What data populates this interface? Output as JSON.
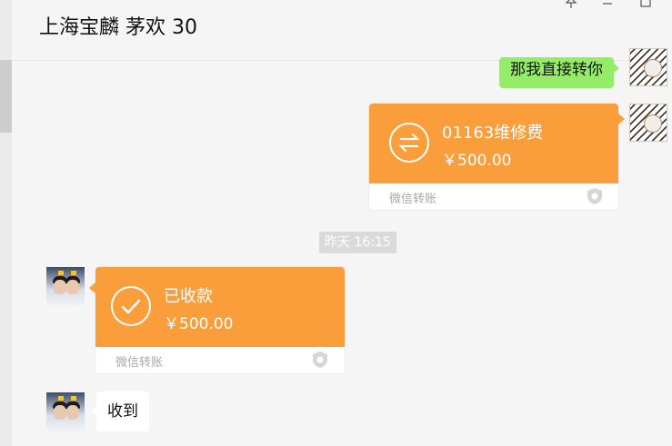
{
  "header": {
    "title": "上海宝麟 茅欢 30",
    "pin_icon": "pin-icon",
    "minimize_icon": "minimize-icon",
    "maximize_icon": "maximize-icon"
  },
  "messages": {
    "m1": {
      "text": "那我直接转你"
    },
    "m2": {
      "type": "transfer",
      "note": "01163维修费",
      "amount": "￥500.00",
      "footer": "微信转账",
      "icon": "transfer-arrows-icon",
      "shield_icon": "shield-icon"
    },
    "timestamp": "昨天 16:15",
    "m3": {
      "type": "transfer",
      "status": "已收款",
      "amount": "￥500.00",
      "footer": "微信转账",
      "icon": "check-icon",
      "shield_icon": "shield-icon"
    },
    "m4": {
      "text": "收到"
    }
  },
  "colors": {
    "background": "#f5f5f5",
    "green_bubble": "#95ec69",
    "transfer_orange": "#fa9d3b"
  }
}
